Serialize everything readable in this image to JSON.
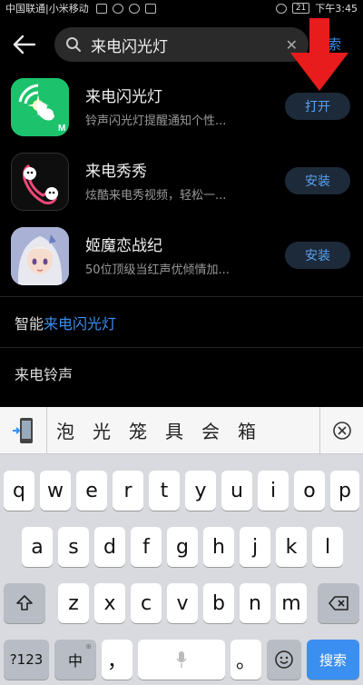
{
  "status_bar": {
    "carrier": "中国联通|小米移动",
    "battery": "21",
    "time": "下午3:45"
  },
  "search": {
    "query": "来电闪光灯",
    "search_label": "搜索"
  },
  "apps": [
    {
      "name": "来电闪光灯",
      "desc": "铃声闪光灯提醒通知个性...",
      "button": "打开"
    },
    {
      "name": "来电秀秀",
      "desc": "炫酷来电秀视频，轻松一...",
      "button": "安装"
    },
    {
      "name": "姬魔恋战纪",
      "desc": "50位顶级当红声优倾情加...",
      "button": "安装"
    }
  ],
  "suggestions": [
    {
      "prefix": "智能",
      "highlight": "来电闪光灯"
    },
    {
      "prefix": "来电铃声",
      "highlight": ""
    }
  ],
  "keyboard": {
    "candidates": [
      "泡",
      "光",
      "笼",
      "具",
      "会",
      "箱"
    ],
    "row1": [
      "q",
      "w",
      "e",
      "r",
      "t",
      "y",
      "u",
      "i",
      "o",
      "p"
    ],
    "row2": [
      "a",
      "s",
      "d",
      "f",
      "g",
      "h",
      "j",
      "k",
      "l"
    ],
    "row3": [
      "z",
      "x",
      "c",
      "v",
      "b",
      "n",
      "m"
    ],
    "num_label": "?123",
    "lang_label": "中",
    "comma": "，",
    "period": "。",
    "enter_label": "搜索"
  },
  "colors": {
    "accent": "#3a8ff0",
    "arrow": "#e81c1c"
  }
}
